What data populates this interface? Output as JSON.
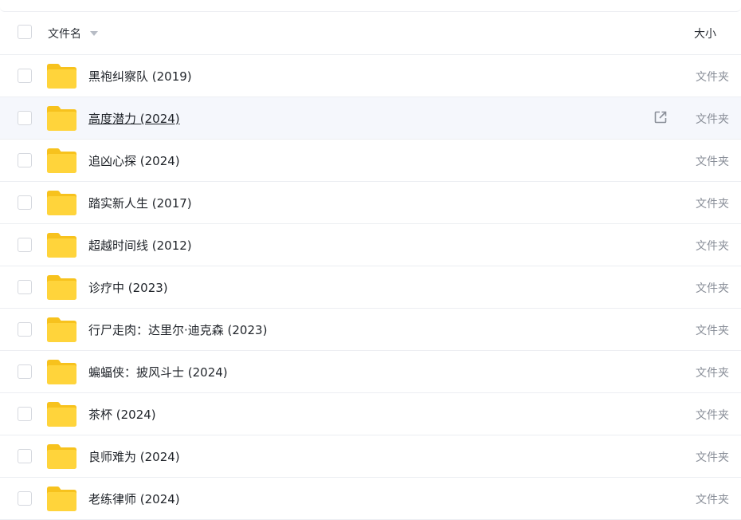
{
  "header": {
    "name_label": "文件名",
    "size_label": "大小"
  },
  "files": [
    {
      "name": "黑袍纠察队 (2019)",
      "size": "文件夹"
    },
    {
      "name": "高度潜力 (2024)",
      "size": "文件夹"
    },
    {
      "name": "追凶心探 (2024)",
      "size": "文件夹"
    },
    {
      "name": "踏实新人生 (2017)",
      "size": "文件夹"
    },
    {
      "name": "超越时间线 (2012)",
      "size": "文件夹"
    },
    {
      "name": "诊疗中 (2023)",
      "size": "文件夹"
    },
    {
      "name": "行尸走肉：达里尔·迪克森 (2023)",
      "size": "文件夹"
    },
    {
      "name": "蝙蝠侠：披风斗士 (2024)",
      "size": "文件夹"
    },
    {
      "name": "茶杯 (2024)",
      "size": "文件夹"
    },
    {
      "name": "良师难为 (2024)",
      "size": "文件夹"
    },
    {
      "name": "老练律师 (2024)",
      "size": "文件夹"
    }
  ],
  "hovered_row": 1,
  "icons": {
    "folder": "folder-icon",
    "share": "open-external-icon",
    "sort": "sort-down-icon"
  },
  "colors": {
    "folder_body": "#ffd43b",
    "folder_tab": "#f7c21d",
    "hover_bg": "#f5f7fc",
    "secondary_text": "#8a8f99"
  }
}
